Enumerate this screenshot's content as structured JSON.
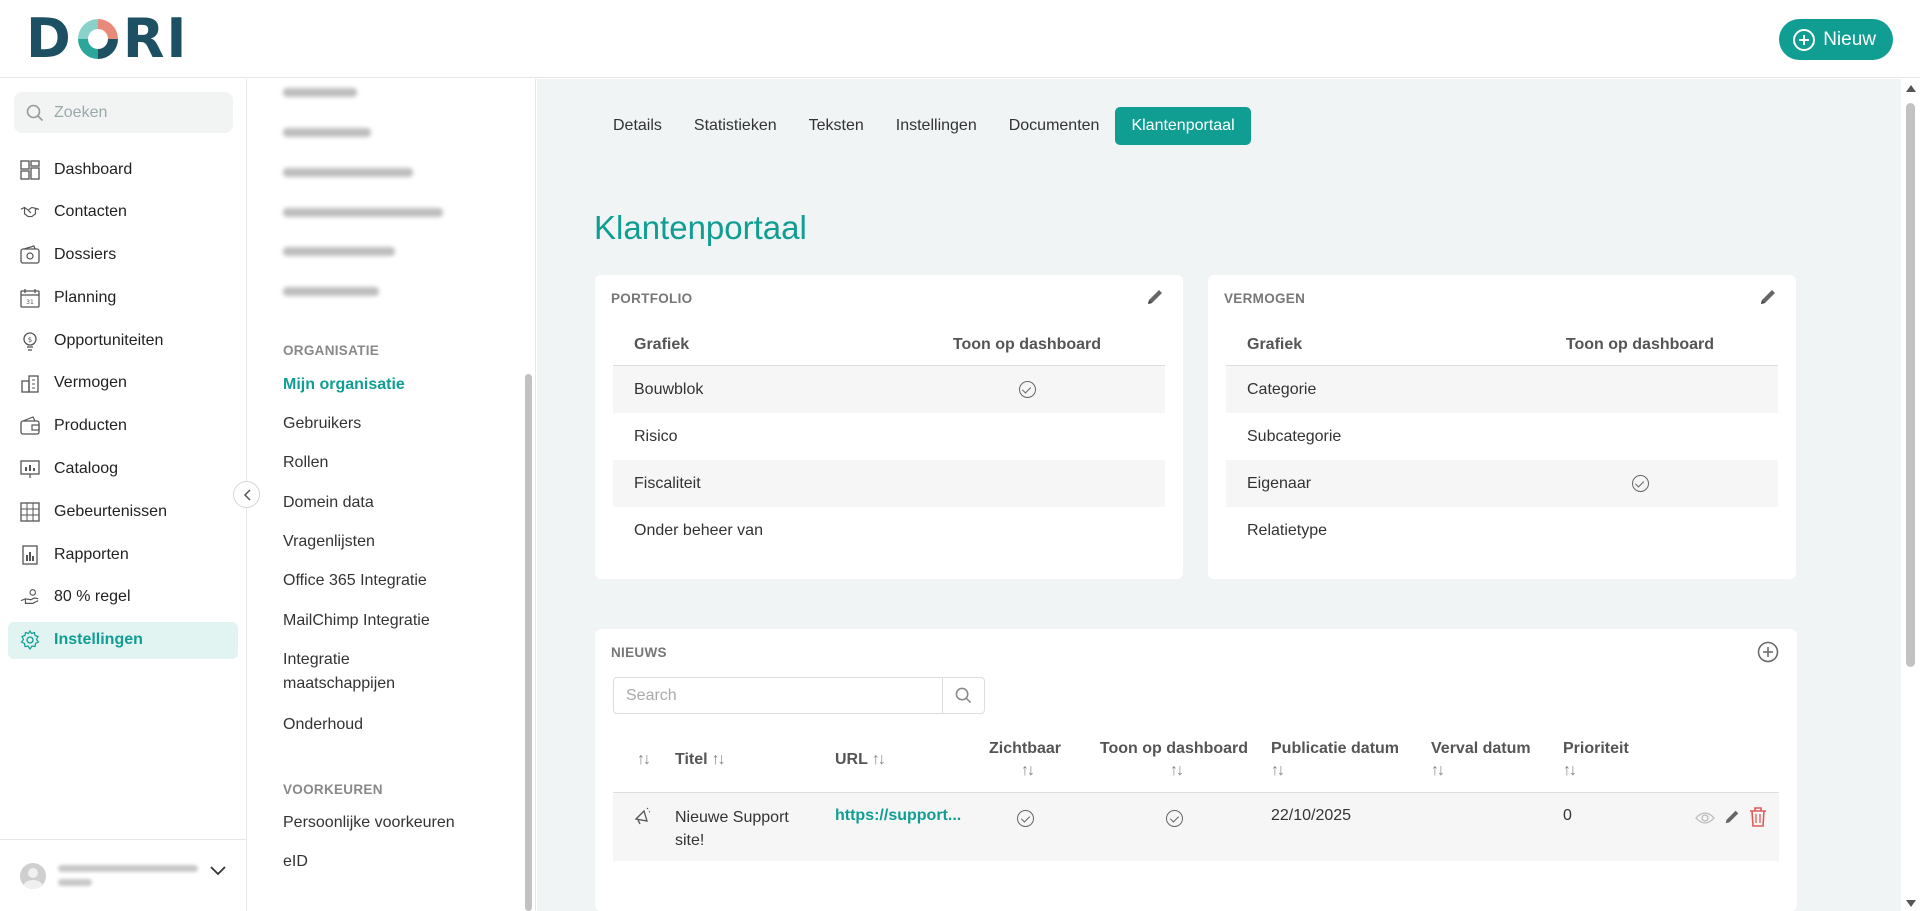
{
  "header": {
    "logo_text_left": "D",
    "logo_text_right": "RI",
    "new_button_label": "Nieuw"
  },
  "sidebar": {
    "search_placeholder": "Zoeken",
    "items": [
      {
        "label": "Dashboard",
        "icon": "dashboard-icon"
      },
      {
        "label": "Contacten",
        "icon": "handshake-icon"
      },
      {
        "label": "Dossiers",
        "icon": "wallet-icon"
      },
      {
        "label": "Planning",
        "icon": "calendar-icon"
      },
      {
        "label": "Opportuniteiten",
        "icon": "lightbulb-icon"
      },
      {
        "label": "Vermogen",
        "icon": "buildings-icon"
      },
      {
        "label": "Producten",
        "icon": "wallet-icon"
      },
      {
        "label": "Cataloog",
        "icon": "chart-board-icon"
      },
      {
        "label": "Gebeurtenissen",
        "icon": "grid-calendar-icon"
      },
      {
        "label": "Rapporten",
        "icon": "report-icon"
      },
      {
        "label": "80 % regel",
        "icon": "hand-money-icon"
      },
      {
        "label": "Instellingen",
        "icon": "gear-icon",
        "active": true
      }
    ]
  },
  "subnav": {
    "section_org": "ORGANISATIE",
    "org_items": [
      {
        "label": "Mijn organisatie",
        "active": true
      },
      {
        "label": "Gebruikers"
      },
      {
        "label": "Rollen"
      },
      {
        "label": "Domein data"
      },
      {
        "label": "Vragenlijsten"
      },
      {
        "label": "Office 365 Integratie"
      },
      {
        "label": "MailChimp Integratie"
      },
      {
        "label": "Integratie maatschappijen"
      },
      {
        "label": "Onderhoud"
      }
    ],
    "section_pref": "VOORKEUREN",
    "pref_items": [
      {
        "label": "Persoonlijke voorkeuren"
      },
      {
        "label": "eID"
      }
    ]
  },
  "tabs": [
    "Details",
    "Statistieken",
    "Teksten",
    "Instellingen",
    "Documenten",
    "Klantenportaal"
  ],
  "active_tab": "Klantenportaal",
  "page_title": "Klantenportaal",
  "portfolio": {
    "title": "PORTFOLIO",
    "col_chart": "Grafiek",
    "col_dashboard": "Toon op dashboard",
    "rows": [
      {
        "label": "Bouwblok",
        "shown": true
      },
      {
        "label": "Risico",
        "shown": false
      },
      {
        "label": "Fiscaliteit",
        "shown": false
      },
      {
        "label": "Onder beheer van",
        "shown": false
      }
    ]
  },
  "vermogen": {
    "title": "VERMOGEN",
    "col_chart": "Grafiek",
    "col_dashboard": "Toon op dashboard",
    "rows": [
      {
        "label": "Categorie",
        "shown": false
      },
      {
        "label": "Subcategorie",
        "shown": false
      },
      {
        "label": "Eigenaar",
        "shown": true
      },
      {
        "label": "Relatietype",
        "shown": false
      }
    ]
  },
  "news": {
    "title": "NIEUWS",
    "search_placeholder": "Search",
    "columns": {
      "title": "Titel",
      "url": "URL",
      "visible": "Zichtbaar",
      "dashboard": "Toon op dashboard",
      "pub_date": "Publicatie datum",
      "exp_date": "Verval datum",
      "priority": "Prioriteit"
    },
    "sort_glyph": "↑↓",
    "rows": [
      {
        "title": "Nieuwe Support site!",
        "url": "https://support...",
        "visible": true,
        "dashboard": true,
        "pub_date": "22/10/2025",
        "exp_date": "",
        "priority": "0"
      }
    ]
  },
  "colors": {
    "accent": "#109e93",
    "logo_dark": "#1d5062",
    "background": "#f0f4f4",
    "delete": "#e05a5a"
  }
}
